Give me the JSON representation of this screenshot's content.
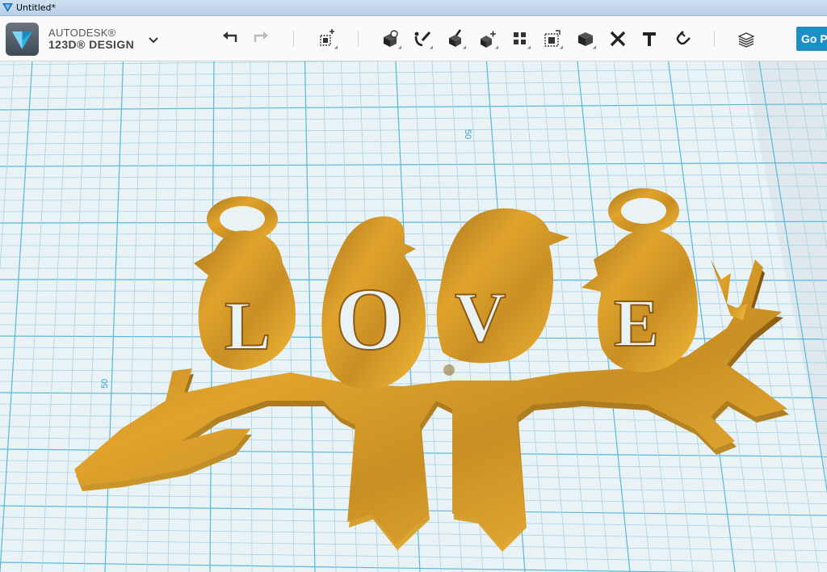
{
  "window": {
    "title": "Untitled*"
  },
  "logo": {
    "line1": "AUTODESK®",
    "line2": "123D® DESIGN"
  },
  "toolbar": {
    "tools": [
      {
        "name": "undo",
        "icon": "undo-icon"
      },
      {
        "name": "redo",
        "icon": "redo-icon"
      },
      {
        "name": "transform",
        "icon": "transform-icon"
      },
      {
        "name": "primitives",
        "icon": "primitives-icon"
      },
      {
        "name": "sketch",
        "icon": "sketch-icon"
      },
      {
        "name": "construct",
        "icon": "construct-icon"
      },
      {
        "name": "modify",
        "icon": "modify-icon"
      },
      {
        "name": "pattern",
        "icon": "pattern-icon"
      },
      {
        "name": "grouping",
        "icon": "grouping-icon"
      },
      {
        "name": "combine",
        "icon": "combine-icon"
      },
      {
        "name": "measure",
        "icon": "measure-icon"
      },
      {
        "name": "text",
        "icon": "text-icon"
      },
      {
        "name": "snap",
        "icon": "snap-icon"
      },
      {
        "name": "material",
        "icon": "material-icon"
      }
    ],
    "go_label": "Go P"
  },
  "viewport": {
    "grid_labels": [
      "50",
      "50",
      "50"
    ],
    "model_letters": [
      "L",
      "O",
      "V",
      "E"
    ],
    "colors": {
      "grid_bg": "#e9f2f5",
      "grid_minor": "#a8d4e4",
      "grid_major": "#5ab8da",
      "model": "#d99a2b"
    }
  }
}
